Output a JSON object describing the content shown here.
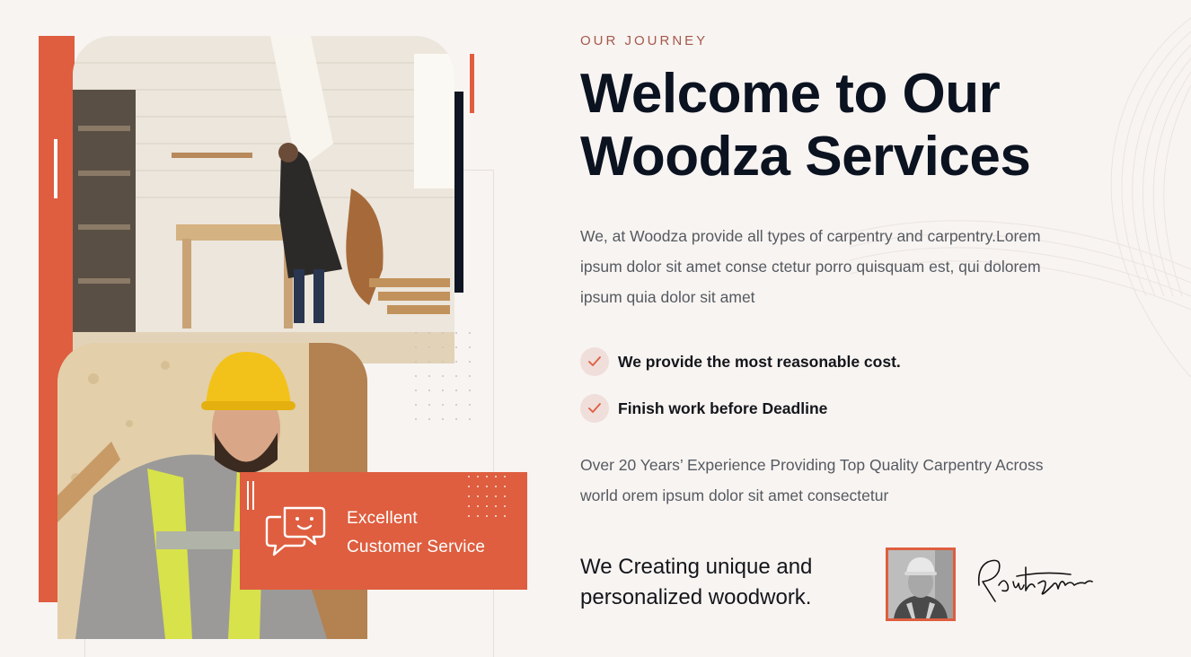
{
  "about": {
    "eyebrow": "OUR JOURNEY",
    "headline_line1": "Welcome to Our",
    "headline_line2": "Woodza Services",
    "intro": "We, at Woodza provide all types of carpentry and carpentry.Lorem ipsum dolor sit amet conse ctetur porro quisquam est, qui dolorem ipsum quia dolor sit amet",
    "features": [
      "We provide the most reasonable cost.",
      "Finish work before Deadline"
    ],
    "experience": "Over 20 Years’ Experience Providing Top Quality Carpentry Across world orem ipsum dolor sit amet consectetur",
    "tagline": "We Creating unique and personalized woodwork."
  },
  "service_card": {
    "line1": "Excellent",
    "line2": "Customer Service"
  },
  "colors": {
    "accent": "#de5e3f",
    "dark": "#0b1220",
    "background": "#f8f4f2"
  },
  "icons": {
    "card": "chat-bubbles-icon",
    "check": "check-icon"
  }
}
